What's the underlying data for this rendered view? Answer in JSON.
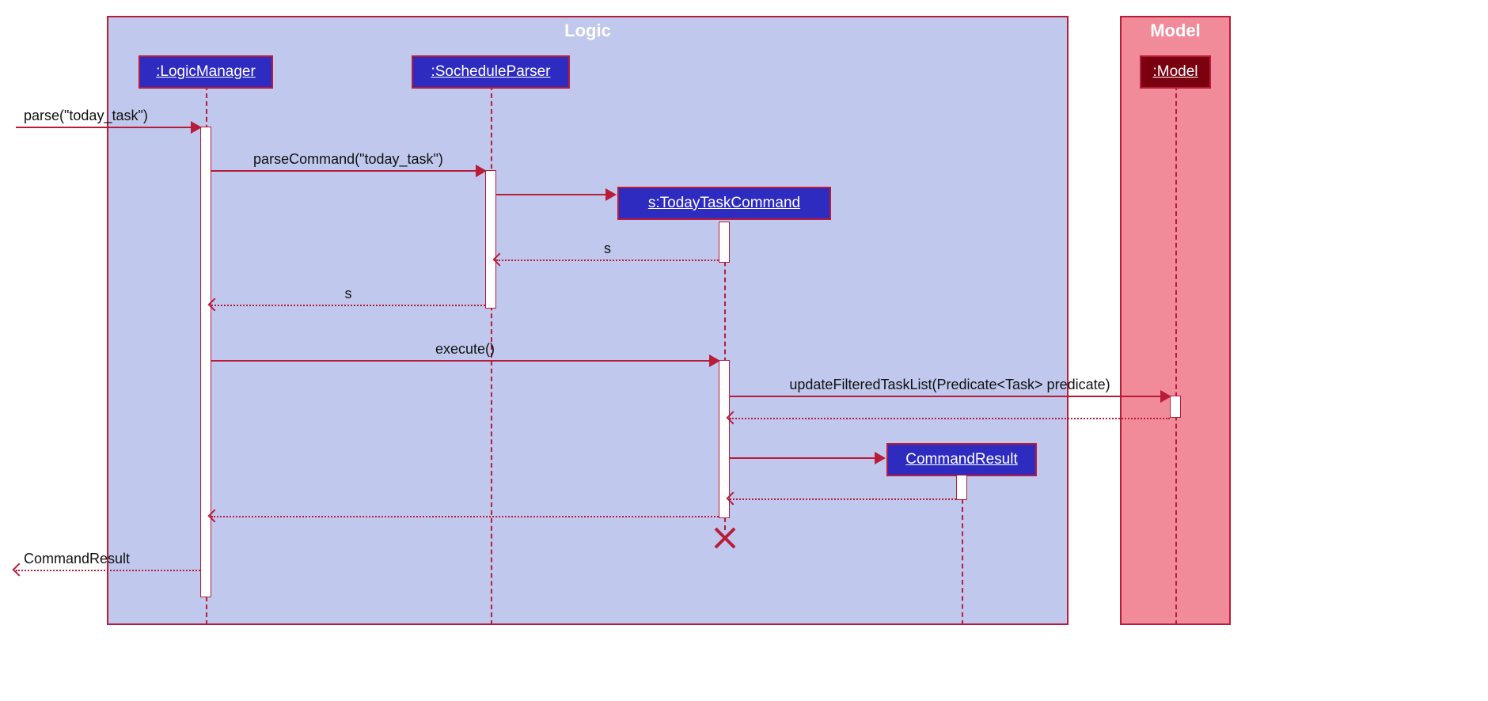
{
  "frames": {
    "logic": "Logic",
    "model": "Model"
  },
  "participants": {
    "logicManager": ":LogicManager",
    "socheduleParser": ":SocheduleParser",
    "todayTaskCommand": "s:TodayTaskCommand",
    "commandResult": "CommandResult",
    "model": ":Model"
  },
  "messages": {
    "parseIn": "parse(\"today_task\")",
    "parseCommand": "parseCommand(\"today_task\")",
    "returnS1": "s",
    "returnS2": "s",
    "execute": "execute()",
    "updateFiltered": "updateFilteredTaskList(Predicate<Task> predicate)",
    "commandResultOut": "CommandResult"
  },
  "chart_data": {
    "type": "uml-sequence",
    "frames": [
      {
        "name": "Logic",
        "contains": [
          "LogicManager",
          "SocheduleParser",
          "TodayTaskCommand",
          "CommandResult"
        ]
      },
      {
        "name": "Model",
        "contains": [
          "Model"
        ]
      }
    ],
    "participants": [
      "External",
      "LogicManager",
      "SocheduleParser",
      "TodayTaskCommand",
      "CommandResult",
      "Model"
    ],
    "events": [
      {
        "from": "External",
        "to": "LogicManager",
        "label": "parse(\"today_task\")",
        "type": "call"
      },
      {
        "from": "LogicManager",
        "to": "SocheduleParser",
        "label": "parseCommand(\"today_task\")",
        "type": "call"
      },
      {
        "from": "SocheduleParser",
        "to": "TodayTaskCommand",
        "label": "",
        "type": "create"
      },
      {
        "from": "TodayTaskCommand",
        "to": "SocheduleParser",
        "label": "s",
        "type": "return"
      },
      {
        "from": "SocheduleParser",
        "to": "LogicManager",
        "label": "s",
        "type": "return"
      },
      {
        "from": "LogicManager",
        "to": "TodayTaskCommand",
        "label": "execute()",
        "type": "call"
      },
      {
        "from": "TodayTaskCommand",
        "to": "Model",
        "label": "updateFilteredTaskList(Predicate<Task> predicate)",
        "type": "call"
      },
      {
        "from": "Model",
        "to": "TodayTaskCommand",
        "label": "",
        "type": "return"
      },
      {
        "from": "TodayTaskCommand",
        "to": "CommandResult",
        "label": "",
        "type": "create"
      },
      {
        "from": "CommandResult",
        "to": "TodayTaskCommand",
        "label": "",
        "type": "return"
      },
      {
        "from": "TodayTaskCommand",
        "to": "LogicManager",
        "label": "",
        "type": "return"
      },
      {
        "from": "TodayTaskCommand",
        "type": "destroy"
      },
      {
        "from": "LogicManager",
        "to": "External",
        "label": "CommandResult",
        "type": "return"
      }
    ]
  }
}
